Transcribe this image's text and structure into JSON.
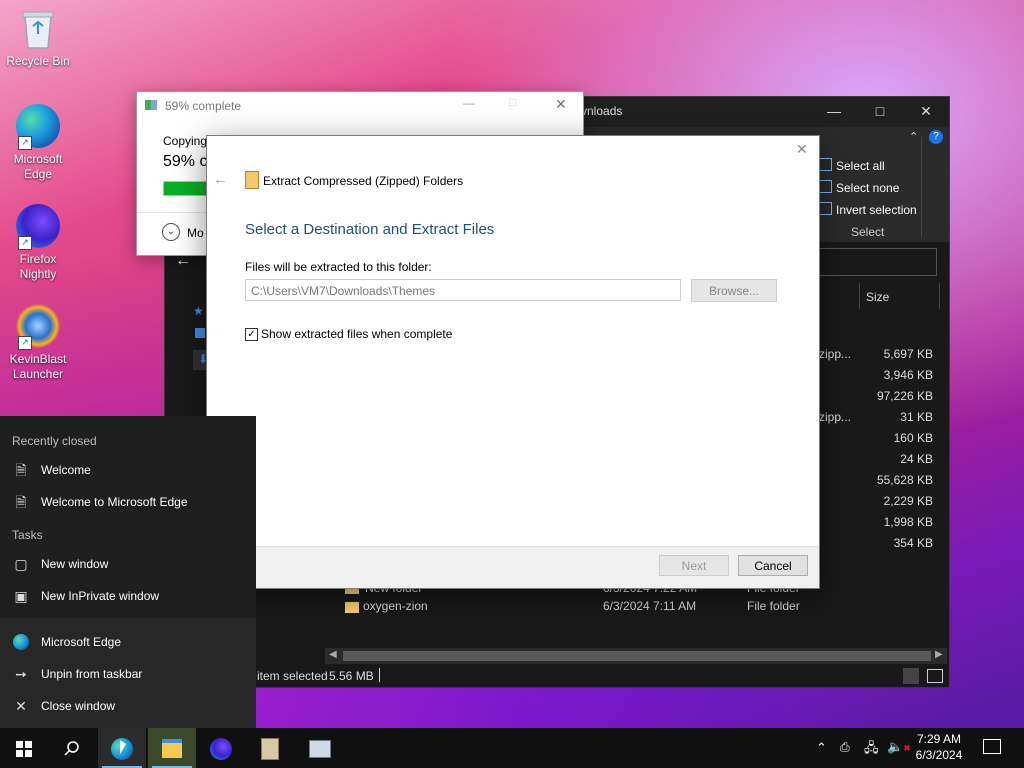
{
  "desktop": {
    "icons": [
      {
        "label": "Recycle Bin"
      },
      {
        "label": "Microsoft Edge"
      },
      {
        "label": "Firefox Nightly"
      },
      {
        "label": "KevinBlast Launcher"
      }
    ]
  },
  "explorer": {
    "title_partial": "vnloads",
    "ribbon": {
      "select_all": "Select all",
      "select_none": "Select none",
      "invert_selection": "Invert selection",
      "group_label": "Select"
    },
    "column_size": "Size",
    "rows": [
      {
        "type_partial": "zipp...",
        "size": "5,697 KB"
      },
      {
        "type_partial": "",
        "size": "3,946 KB"
      },
      {
        "type_partial": "",
        "size": "97,226 KB"
      },
      {
        "type_partial": "zipp...",
        "size": "31 KB"
      },
      {
        "type_partial": "",
        "size": "160 KB"
      },
      {
        "type_partial": "",
        "size": "24 KB"
      },
      {
        "type_partial": "",
        "size": "55,628 KB"
      },
      {
        "type_partial": "",
        "size": "2,229 KB"
      },
      {
        "type_partial": "",
        "size": "1,998 KB"
      },
      {
        "type_partial": "",
        "size": "354 KB"
      }
    ],
    "partial_row": {
      "name": "New folder",
      "date": "6/3/2024 7:22 AM",
      "type": "File folder"
    },
    "last_row": {
      "name": "oxygen-zion",
      "date": "6/3/2024 7:11 AM",
      "type": "File folder"
    },
    "status": {
      "selected": "item selected",
      "size": "5.56 MB"
    }
  },
  "progress": {
    "title": "59% complete",
    "copying": "Copying",
    "percent": "59% co",
    "progress_fraction": 0.59,
    "more": "Mo"
  },
  "wizard": {
    "title": "Extract Compressed (Zipped) Folders",
    "heading": "Select a Destination and Extract Files",
    "dest_label": "Files will be extracted to this folder:",
    "dest_value": "C:\\Users\\VM7\\Downloads\\Themes",
    "browse": "Browse...",
    "checkbox_label": "Show extracted files when complete",
    "checkbox_checked": true,
    "next": "Next",
    "cancel": "Cancel"
  },
  "jumplist": {
    "recently_closed": "Recently closed",
    "recent_items": [
      "Welcome",
      "Welcome to Microsoft Edge"
    ],
    "tasks": "Tasks",
    "task_items": [
      "New window",
      "New InPrivate window"
    ],
    "app_name": "Microsoft Edge",
    "unpin": "Unpin from taskbar",
    "close": "Close window"
  },
  "taskbar": {
    "time": "7:29 AM",
    "date": "6/3/2024"
  },
  "colors": {
    "accent": "#0078d7",
    "progress_green": "#06b025",
    "heading_blue": "#1e4e8c"
  }
}
